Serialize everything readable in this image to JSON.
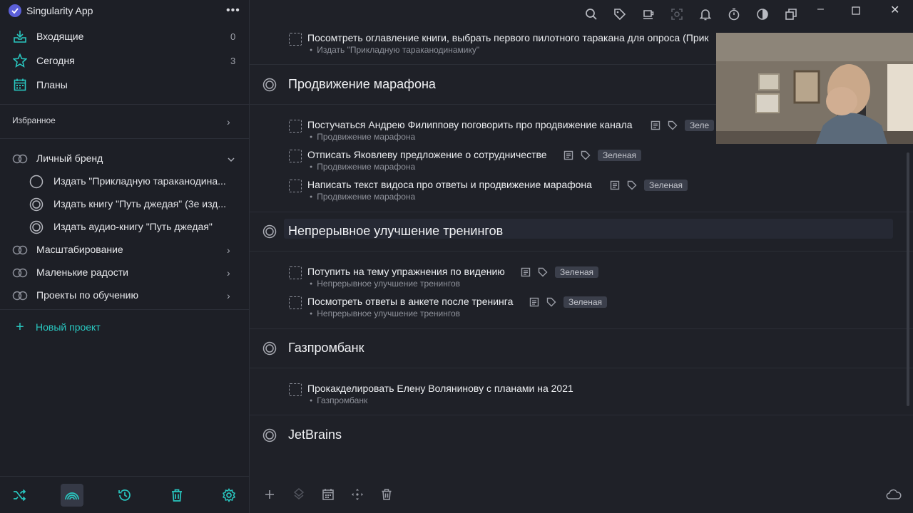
{
  "app": {
    "title": "Singularity App",
    "more": "•••"
  },
  "colors": {
    "accent": "#29c7c0",
    "bg": "#1f2128",
    "sidebar": "#1d1f26",
    "tag_bg": "#3b3f4b"
  },
  "sidebar": {
    "nav": [
      {
        "label": "Входящие",
        "count": "0",
        "icon": "inbox-icon"
      },
      {
        "label": "Сегодня",
        "count": "3",
        "icon": "star-icon"
      },
      {
        "label": "Планы",
        "count": "",
        "icon": "calendar-icon"
      }
    ],
    "favorites_label": "Избранное",
    "projects": [
      {
        "label": "Личный бренд",
        "expanded": true
      },
      {
        "label": "Масштабирование"
      },
      {
        "label": "Маленькие радости"
      },
      {
        "label": "Проекты по обучению"
      }
    ],
    "subprojects": [
      {
        "label": "Издать \"Прикладную тараканодина..."
      },
      {
        "label": "Издать книгу \"Путь джедая\" (3е изд..."
      },
      {
        "label": "Издать аудио-книгу \"Путь джедая\""
      }
    ],
    "new_project": "Новый проект",
    "toolbar_icons": [
      "shuffle-icon",
      "rainbow-icon",
      "history-icon",
      "trash-icon",
      "settings-icon"
    ]
  },
  "main": {
    "top_task": {
      "title": "Посомтреть оглавление книги, выбрать первого пилотного таракана для опроса (Прик",
      "project": "Издать \"Прикладную тараканодинамику\""
    },
    "groups": [
      {
        "title": "Продвижение марафона",
        "tasks": [
          {
            "title": "Постучаться Андрею Филиппову поговорить про продвижение канала",
            "project": "Продвижение марафона",
            "tag": "Зеле"
          },
          {
            "title": "Отписать Яковлеву предложение о сотрудничестве",
            "project": "Продвижение марафона",
            "tag": "Зеленая"
          },
          {
            "title": "Написать текст видоса про ответы и продвижение марафона",
            "project": "Продвижение марафона",
            "tag": "Зеленая"
          }
        ]
      },
      {
        "title": "Непрерывное улучшение тренингов",
        "tasks": [
          {
            "title": "Потупить на тему упражнения по видению",
            "project": "Непрерывное улучшение тренингов",
            "tag": "Зеленая"
          },
          {
            "title": "Посмотреть ответы в анкете после тренинга",
            "project": "Непрерывное улучшение тренингов",
            "tag": "Зеленая"
          }
        ]
      },
      {
        "title": "Газпромбанк",
        "tasks": [
          {
            "title": "Прокакделировать Елену Волянинову с планами на 2021",
            "project": "Газпромбанк"
          }
        ]
      },
      {
        "title": "JetBrains",
        "tasks": []
      }
    ]
  }
}
